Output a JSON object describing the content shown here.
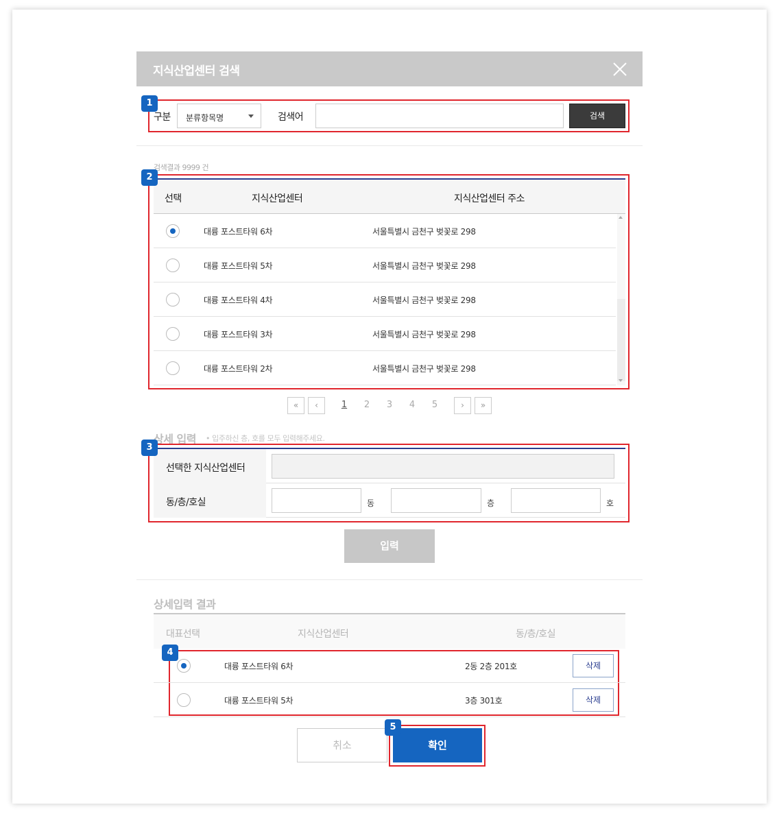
{
  "modal": {
    "title": "지식산업센터 검색"
  },
  "markers": [
    "1",
    "2",
    "3",
    "4",
    "5"
  ],
  "search": {
    "category_label": "구분",
    "category_value": "분류항목명",
    "keyword_label": "검색어",
    "keyword_value": "",
    "search_button": "검색"
  },
  "results": {
    "count_text": "검색결과 9999 건",
    "headers": {
      "select": "선택",
      "center": "지식산업센터",
      "address": "지식산업센터 주소"
    },
    "rows": [
      {
        "name": "대륭 포스트타워 6차",
        "address": "서울특별시 금천구 벚꽃로 298",
        "selected": true
      },
      {
        "name": "대륭 포스트타워 5차",
        "address": "서울특별시 금천구 벚꽃로 298",
        "selected": false
      },
      {
        "name": "대륭 포스트타워 4차",
        "address": "서울특별시 금천구 벚꽃로 298",
        "selected": false
      },
      {
        "name": "대륭 포스트타워 3차",
        "address": "서울특별시 금천구 벚꽃로 298",
        "selected": false
      },
      {
        "name": "대륭 포스트타워 2차",
        "address": "서울특별시 금천구 벚꽃로 298",
        "selected": false
      }
    ]
  },
  "pagination": {
    "first": "«",
    "prev": "‹",
    "next": "›",
    "last": "»",
    "pages": [
      "1",
      "2",
      "3",
      "4",
      "5"
    ],
    "current": "1"
  },
  "detail": {
    "title": "상세 입력",
    "note": "• 입주하신 층, 호를 모두 입력해주세요.",
    "selected_center_label": "선택한 지식산업센터",
    "selected_center_value": "",
    "location_label": "동/층/호실",
    "dong_value": "",
    "dong_unit": "동",
    "floor_value": "",
    "floor_unit": "층",
    "room_value": "",
    "room_unit": "호",
    "enter_button": "입력"
  },
  "detail_results": {
    "title": "상세입력 결과",
    "headers": {
      "rep": "대표선택",
      "center": "지식산업센터",
      "location": "동/층/호실"
    },
    "rows": [
      {
        "name": "대륭 포스트타워 6차",
        "location": "2동 2층 201호",
        "selected": true,
        "delete": "삭제"
      },
      {
        "name": "대륭 포스트타워 5차",
        "location": "3층 301호",
        "selected": false,
        "delete": "삭제"
      }
    ]
  },
  "footer": {
    "cancel": "취소",
    "confirm": "확인"
  },
  "colors": {
    "accent": "#1565c0",
    "highlight": "#e0252c",
    "header_bg": "#c9c9c9",
    "table_rule": "#2a3d8f"
  }
}
